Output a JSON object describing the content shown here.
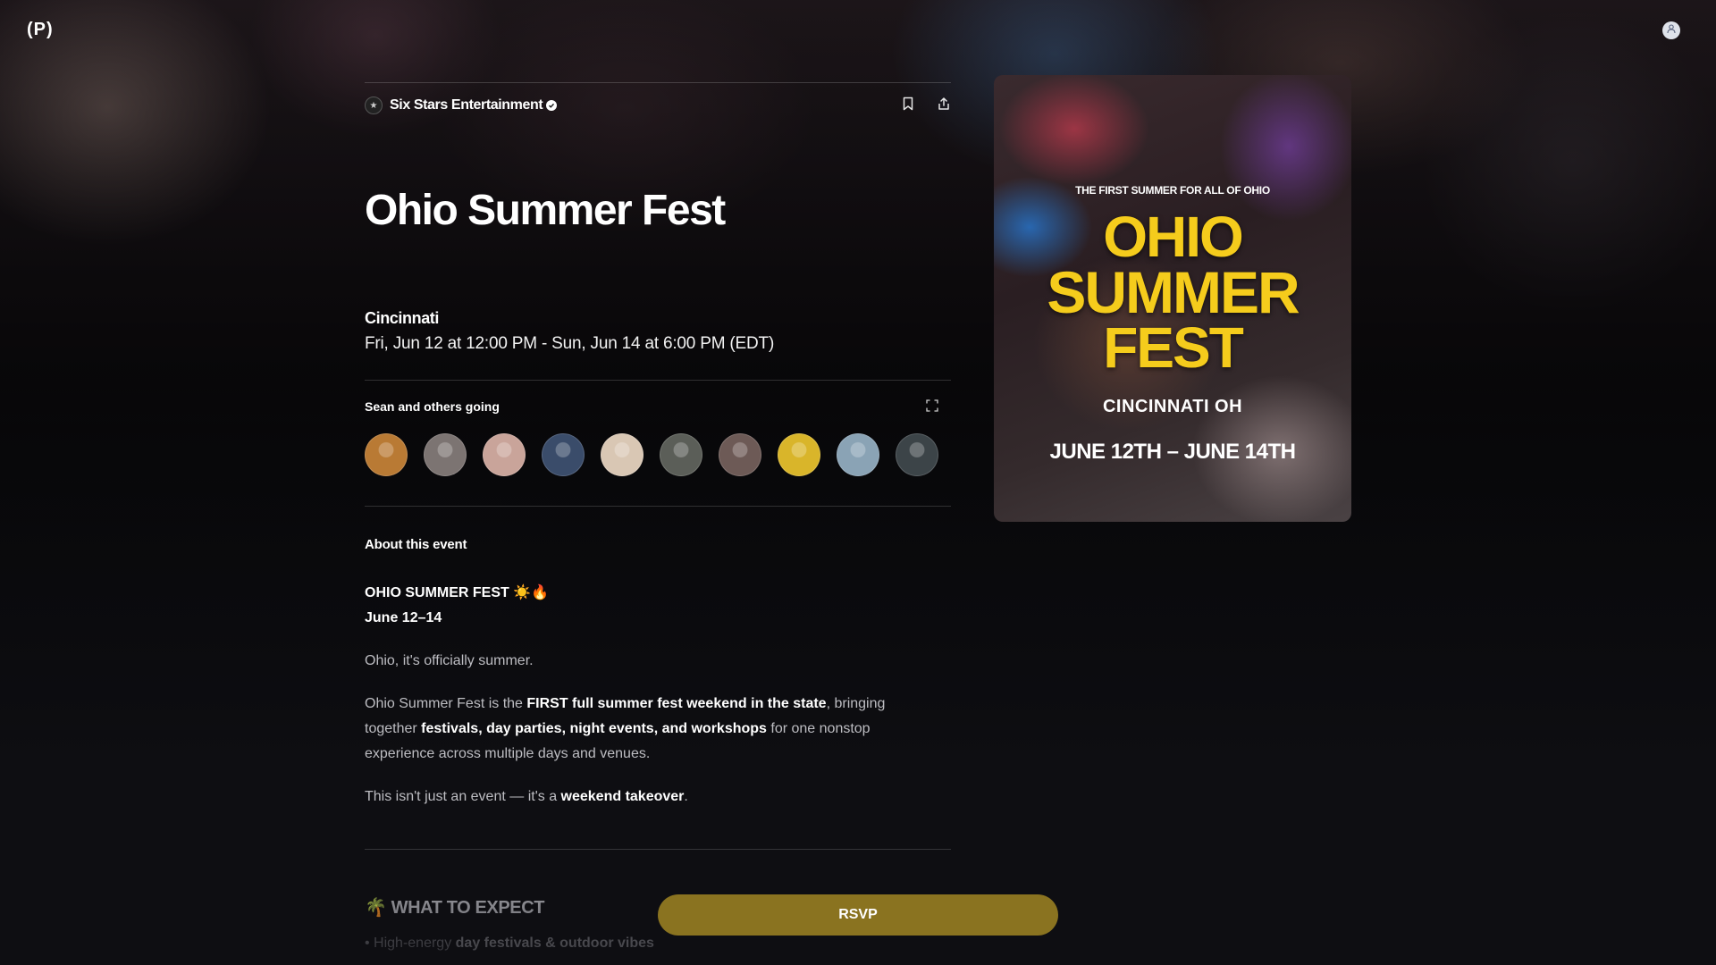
{
  "app": {
    "logo_text": "(P)"
  },
  "event": {
    "organizer": "Six Stars Entertainment",
    "title": "Ohio Summer Fest",
    "city": "Cincinnati",
    "dates": "Fri, Jun 12 at 12:00 PM - Sun, Jun 14 at 6:00 PM (EDT)"
  },
  "attendees": {
    "label": "Sean and others going",
    "avatar_colors": [
      "#b97a34",
      "#7c7472",
      "#c9a49a",
      "#3a4c6a",
      "#d9c7b4",
      "#5b5e58",
      "#6d5a56",
      "#d9b52a",
      "#8aa3b5",
      "#3c4448"
    ]
  },
  "about": {
    "label": "About this event",
    "headline": "OHIO SUMMER FEST ☀️🔥",
    "dates_line": "June 12–14",
    "p1": "Ohio, it's officially summer.",
    "p2_a": "Ohio Summer Fest is the ",
    "p2_b": "FIRST full summer fest weekend in the state",
    "p2_c": ", bringing together ",
    "p2_d": "festivals, day parties, night events, and workshops",
    "p2_e": " for one nonstop experience across multiple days and venues.",
    "p3_a": "This isn't just an event — it's a ",
    "p3_b": "weekend takeover",
    "p3_c": ".",
    "expect_heading": "🌴 WHAT TO EXPECT",
    "bullet_a": "• High-energy ",
    "bullet_b": "day festivals & outdoor vibes"
  },
  "poster": {
    "tagline": "THE FIRST SUMMER FOR ALL OF OHIO",
    "line1": "OHIO",
    "line2": "SUMMER",
    "line3": "FEST",
    "city": "CINCINNATI OH",
    "dates": "JUNE 12TH – JUNE 14TH"
  },
  "actions": {
    "rsvp_label": "RSVP"
  },
  "colors": {
    "accent": "#8a7320",
    "poster_yellow": "#f5cc1c"
  }
}
